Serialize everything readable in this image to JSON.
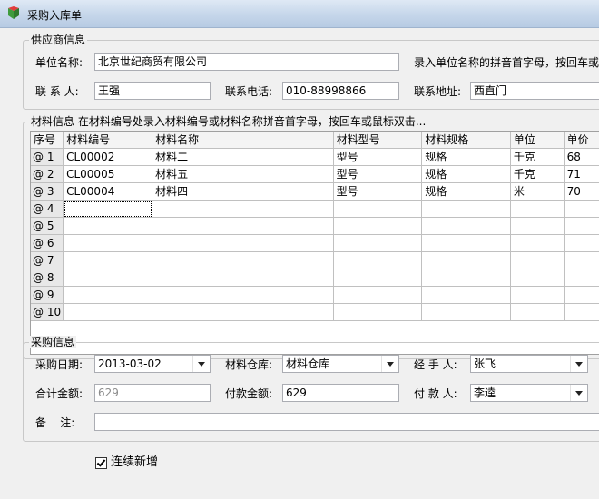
{
  "window": {
    "title": "采购入库单"
  },
  "supplier": {
    "legend": "供应商信息",
    "unit_label": "单位名称:",
    "unit_value": "北京世纪商贸有限公司",
    "hint": "录入单位名称的拼音首字母，按回车或",
    "contact_label": "联 系 人:",
    "contact_value": "王强",
    "phone_label": "联系电话:",
    "phone_value": "010-88998866",
    "address_label": "联系地址:",
    "address_value": "西直门"
  },
  "material": {
    "legend": "材料信息 在材料编号处录入材料编号或材料名称拼音首字母，按回车或鼠标双击...",
    "columns": [
      "序号",
      "材料编号",
      "材料名称",
      "材料型号",
      "材料规格",
      "单位",
      "单价"
    ],
    "rows": [
      {
        "seq": "@ 1",
        "code": "CL00002",
        "name": "材料二",
        "model": "型号",
        "spec": "规格",
        "unit": "千克",
        "price": "68"
      },
      {
        "seq": "@ 2",
        "code": "CL00005",
        "name": "材料五",
        "model": "型号",
        "spec": "规格",
        "unit": "千克",
        "price": "71"
      },
      {
        "seq": "@ 3",
        "code": "CL00004",
        "name": "材料四",
        "model": "型号",
        "spec": "规格",
        "unit": "米",
        "price": "70"
      },
      {
        "seq": "@ 4",
        "code": "",
        "name": "",
        "model": "",
        "spec": "",
        "unit": "",
        "price": ""
      },
      {
        "seq": "@ 5",
        "code": "",
        "name": "",
        "model": "",
        "spec": "",
        "unit": "",
        "price": ""
      },
      {
        "seq": "@ 6",
        "code": "",
        "name": "",
        "model": "",
        "spec": "",
        "unit": "",
        "price": ""
      },
      {
        "seq": "@ 7",
        "code": "",
        "name": "",
        "model": "",
        "spec": "",
        "unit": "",
        "price": ""
      },
      {
        "seq": "@ 8",
        "code": "",
        "name": "",
        "model": "",
        "spec": "",
        "unit": "",
        "price": ""
      },
      {
        "seq": "@ 9",
        "code": "",
        "name": "",
        "model": "",
        "spec": "",
        "unit": "",
        "price": ""
      },
      {
        "seq": "@ 10",
        "code": "",
        "name": "",
        "model": "",
        "spec": "",
        "unit": "",
        "price": ""
      }
    ]
  },
  "purchase": {
    "legend": "采购信息",
    "date_label": "采购日期:",
    "date_value": "2013-03-02",
    "warehouse_label": "材料仓库:",
    "warehouse_value": "材料仓库",
    "handler_label": "经 手 人:",
    "handler_value": "张飞",
    "total_label": "合计金额:",
    "total_value": "629",
    "paid_label": "付款金额:",
    "paid_value": "629",
    "payer_label": "付 款 人:",
    "payer_value": "李逵",
    "note_label": "备    注:",
    "note_value": ""
  },
  "continuous": {
    "label": "连续新增",
    "checked": true
  }
}
